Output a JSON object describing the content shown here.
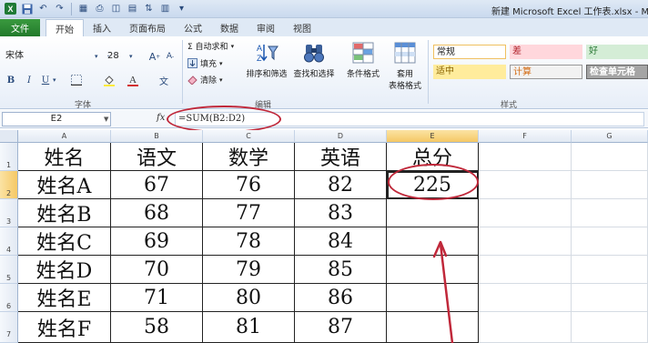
{
  "window_title": "新建 Microsoft Excel 工作表.xlsx - Microso",
  "tabs": [
    "文件",
    "开始",
    "插入",
    "页面布局",
    "公式",
    "数据",
    "审阅",
    "视图"
  ],
  "ribbon": {
    "font_name": "宋体",
    "font_size": "28",
    "bold": "B",
    "italic": "I",
    "underline": "U",
    "font_group": "字体",
    "autosum": "Σ 自动求和",
    "fill": "填充",
    "clear": "清除",
    "sort_filter": "排序和筛选",
    "find_select": "查找和选择",
    "conditional_format": "条件格式",
    "table_format_l1": "套用",
    "table_format_l2": "表格格式",
    "edit_group": "编辑",
    "styles_group": "样式",
    "style_normal": "常规",
    "style_bad": "差",
    "style_good": "好",
    "style_neutral": "适中",
    "style_calc": "计算",
    "style_check": "检查单元格"
  },
  "formula_bar": {
    "cell_ref": "E2",
    "fx": "fx",
    "formula": "=SUM(B2:D2)"
  },
  "columns": [
    "A",
    "B",
    "C",
    "D",
    "E",
    "F",
    "G"
  ],
  "rows": [
    "1",
    "2",
    "3",
    "4",
    "5",
    "6",
    "7"
  ],
  "table": {
    "headers": [
      "姓名",
      "语文",
      "数学",
      "英语",
      "总分"
    ],
    "data": [
      [
        "姓名A",
        "67",
        "76",
        "82",
        "225"
      ],
      [
        "姓名B",
        "68",
        "77",
        "83",
        ""
      ],
      [
        "姓名C",
        "69",
        "78",
        "84",
        ""
      ],
      [
        "姓名D",
        "70",
        "79",
        "85",
        ""
      ],
      [
        "姓名E",
        "71",
        "80",
        "86",
        ""
      ],
      [
        "姓名F",
        "58",
        "81",
        "87",
        ""
      ]
    ]
  },
  "colors": {
    "annotation": "#c0283a",
    "file_tab": "#2e7d32",
    "selection_header": "#f5c865"
  }
}
